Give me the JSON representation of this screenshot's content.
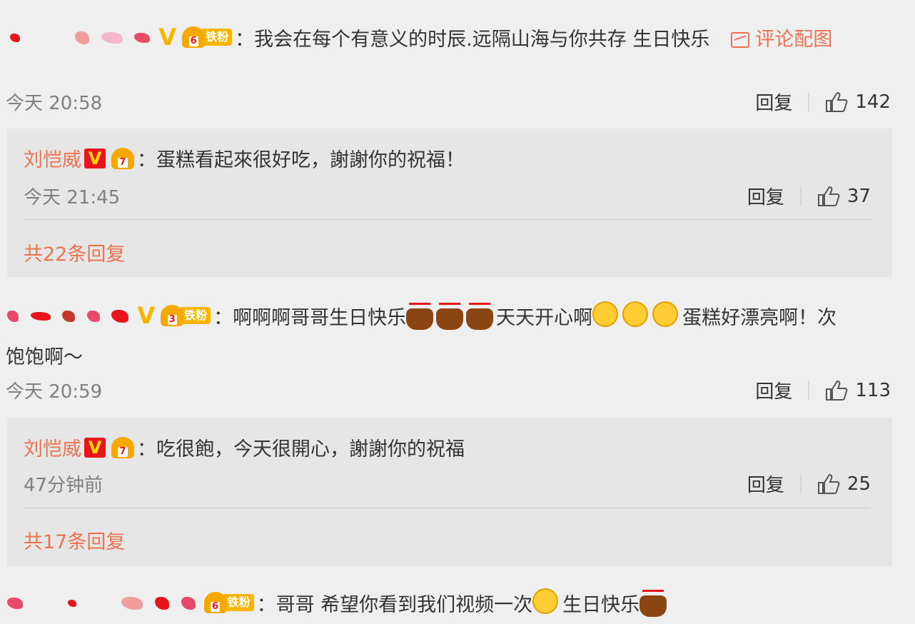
{
  "comments": [
    {
      "text": "：我会在每个有意义的时辰.远隔山海与你共存 生日快乐",
      "fan_level": "6",
      "fan_tag": "铁粉",
      "image_link": "评论配图",
      "time": "今天 20:58",
      "reply_label": "回复",
      "likes": "142",
      "reply": {
        "author": "刘恺威",
        "text": "：蛋糕看起來很好吃，謝謝你的祝福！",
        "time": "今天 21:45",
        "reply_label": "回复",
        "likes": "37",
        "more": "共22条回复"
      }
    },
    {
      "text_a": "：啊啊啊哥哥生日快乐",
      "text_b": "天天开心啊",
      "text_c": "蛋糕好漂亮啊！次",
      "text_d": "饱饱啊～",
      "fan_level": "3",
      "fan_tag": "铁粉",
      "time": "今天 20:59",
      "reply_label": "回复",
      "likes": "113",
      "reply": {
        "author": "刘恺威",
        "text": "：吃很飽，今天很開心，謝謝你的祝福",
        "time": "47分钟前",
        "reply_label": "回复",
        "likes": "25",
        "more": "共17条回复"
      }
    },
    {
      "text_a": "：哥哥 希望你看到我们视频一次",
      "text_b": " 生日快乐",
      "fan_level": "6",
      "fan_tag": "铁粉"
    }
  ],
  "colors": {
    "accent": "#eb7350",
    "verified_red": "#e8151c",
    "badge_gold": "#f7b500",
    "background": "#efefef",
    "reply_background": "#e6e6e6"
  },
  "icons": [
    "verified-v-icon",
    "fan-crown-icon",
    "thumbs-up-icon",
    "picture-icon",
    "cake-emoji-icon",
    "laughing-emoji-icon"
  ]
}
